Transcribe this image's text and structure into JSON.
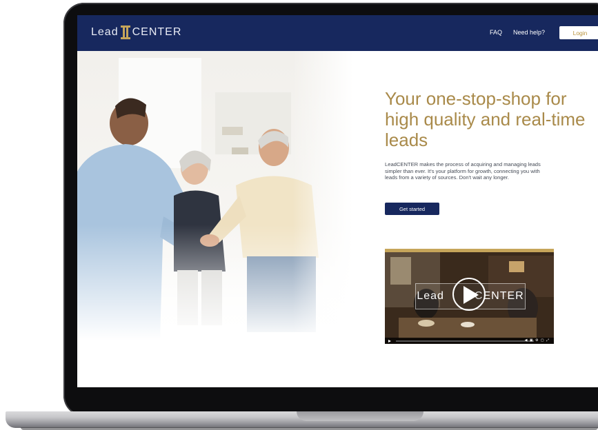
{
  "brand": {
    "name_left": "Lead",
    "name_right": "CENTER",
    "accent": "#b8923d",
    "navy": "#17285e"
  },
  "nav": {
    "links": [
      "FAQ",
      "Need help?"
    ],
    "login_label": "Login"
  },
  "hero": {
    "headline": "Your one-stop-shop for high quality and real-time leads",
    "body": "LeadCENTER makes the process of acquiring and managing leads simpler than ever. It's your platform for growth, connecting you with leads from a variety of sources. Don't wait any longer.",
    "cta_label": "Get started"
  },
  "video": {
    "overlay_left": "Lead",
    "overlay_right": "CENTER",
    "play_icon": "play-icon"
  }
}
